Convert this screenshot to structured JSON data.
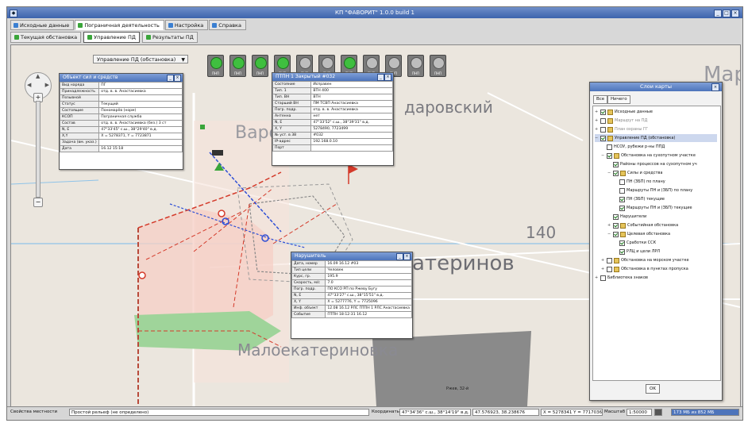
{
  "window": {
    "title": "КП \"ФАВОРИТ\" 1.0.0 build 1",
    "controls": [
      "_",
      "□",
      "×"
    ]
  },
  "tabs": [
    {
      "label": "Исходные данные",
      "color": "#3b7fd1",
      "active": false
    },
    {
      "label": "Пограничная деятельность",
      "color": "#3aa53a",
      "active": true
    },
    {
      "label": "Настройка",
      "color": "#3b7fd1",
      "active": false
    },
    {
      "label": "Справка",
      "color": "#3b7fd1",
      "active": false
    }
  ],
  "subtabs": [
    {
      "label": "Текущая обстановка",
      "active": false
    },
    {
      "label": "Управление ПД",
      "active": true
    },
    {
      "label": "Результаты ПД",
      "active": false
    }
  ],
  "mode_select": {
    "value": "Управление ПД (обстановка)"
  },
  "toolbar_buttons": [
    {
      "label": "ПНП",
      "state": "green"
    },
    {
      "label": "ПНП",
      "state": "green"
    },
    {
      "label": "ПНП",
      "state": "green"
    },
    {
      "label": "ПНП",
      "state": "green"
    },
    {
      "label": "ПНП",
      "state": "grey"
    },
    {
      "label": "ПНП",
      "state": "grey"
    },
    {
      "label": "ПНП",
      "state": "green"
    },
    {
      "label": "ПНП",
      "state": "grey"
    },
    {
      "label": "ПНП",
      "state": "grey"
    },
    {
      "label": "ПНП",
      "state": "grey"
    },
    {
      "label": "ПНП",
      "state": "grey"
    }
  ],
  "map_labels": {
    "place1": "Варе",
    "place2": "даровский",
    "place3": "атеринов",
    "place4": "Малоекатериновка",
    "place5": "Мар",
    "number": "140",
    "field": "Ржев, 32-й"
  },
  "win_object": {
    "title": "Объект сил и средств",
    "rows": [
      [
        "Вид наряда",
        "ПГ"
      ],
      [
        "Принадлежность",
        "отд. в. в. Анастасиевка"
      ],
      [
        "Позывной",
        ""
      ],
      [
        "Статус",
        "Текущий"
      ],
      [
        "Состоящие",
        "Пономарёв (норм)"
      ],
      [
        "КСОП",
        "Пограничная служба"
      ],
      [
        "Состав",
        "отд. в. в. Анастасиевка (без.) 3 ст"
      ],
      [
        "N, E",
        "47°33'45\" с.ш., 38°29'40\" в.д."
      ],
      [
        "X,Y",
        "X = 5278371, Y = 7723871"
      ],
      [
        "Задача (вм. указ.)",
        ""
      ],
      [
        "Дата",
        "16.12 15:18"
      ]
    ]
  },
  "win_ptpn": {
    "title": "ПТПН 1 Закрытый #032",
    "rows": [
      [
        "Состояние",
        "Исправен"
      ],
      [
        "Тип. 1",
        "ВТН 400"
      ],
      [
        "Тип. ВН",
        "ВТН"
      ],
      [
        "Старший ВН",
        "ПМ ТСВП Анастасиевка"
      ],
      [
        "Погр. подр.",
        "отд. в. в. Анастасиевка"
      ],
      [
        "Антенна",
        "нет"
      ],
      [
        "N, E",
        "47°33'52\" с.ш., 38°39'31\" в.д."
      ],
      [
        "X, Y",
        "5278490, 7723499"
      ],
      [
        "№ уст. в 38",
        "#032"
      ],
      [
        "IP-адрес",
        "192.168.0.10"
      ],
      [
        "Порт",
        ""
      ]
    ]
  },
  "win_violator": {
    "title": "Нарушитель",
    "rows": [
      [
        "Дата, номер",
        "16.09 16.12 #03"
      ],
      [
        "Тип цели",
        "Человек"
      ],
      [
        "Курс, гр.",
        "195.9"
      ],
      [
        "Скорость, м/с",
        "7.0"
      ],
      [
        "Погр. подр.",
        "ПО КСО РП по Ржеву Бугу"
      ],
      [
        "N, E",
        "47°33'27\" с.ш., 38°15'51\" в.д."
      ],
      [
        "X, Y",
        "X = 5277776, Y = 7725096"
      ],
      [
        "Инф. объект",
        "12.08 16.12 РЛС ПТПН 1 РЛС Анастасиевка"
      ],
      [
        "Событие",
        "ПТПН 18:12:31 16.12"
      ]
    ]
  },
  "layers_panel": {
    "title": "Слои карты",
    "btn_all": "Все",
    "btn_none": "Ничего",
    "ok": "OK",
    "items": [
      {
        "label": "Исходные данные",
        "depth": 0,
        "checked": true,
        "folder": true,
        "exp": "+"
      },
      {
        "label": "Маршрут на ПД",
        "depth": 0,
        "checked": false,
        "folder": true,
        "exp": "+"
      },
      {
        "label": "План охраны ГГ",
        "depth": 0,
        "checked": false,
        "folder": true,
        "exp": "+"
      },
      {
        "label": "Управление ПД (обстановка)",
        "depth": 0,
        "checked": true,
        "folder": true,
        "exp": "−",
        "selected": true
      },
      {
        "label": "НСОУ, рубежи р-ны ППД",
        "depth": 1,
        "checked": false,
        "folder": false,
        "exp": ""
      },
      {
        "label": "Обстановка на сухопутном участке",
        "depth": 1,
        "checked": true,
        "folder": true,
        "exp": "−"
      },
      {
        "label": "Районы процессов на сухопутном уч",
        "depth": 2,
        "checked": true,
        "folder": false,
        "exp": ""
      },
      {
        "label": "Силы и средства",
        "depth": 2,
        "checked": true,
        "folder": true,
        "exp": "−"
      },
      {
        "label": "ПН (ЗБП) по плану",
        "depth": 3,
        "checked": false,
        "folder": false,
        "exp": ""
      },
      {
        "label": "Маршруты ПН и (ЗБП) по плану",
        "depth": 3,
        "checked": false,
        "folder": false,
        "exp": ""
      },
      {
        "label": "ПН (ЗБП) текущие",
        "depth": 3,
        "checked": true,
        "folder": false,
        "exp": ""
      },
      {
        "label": "Маршруты ПН и (ЗБП) текущие",
        "depth": 3,
        "checked": true,
        "folder": false,
        "exp": ""
      },
      {
        "label": "Нарушители",
        "depth": 2,
        "checked": true,
        "folder": false,
        "exp": ""
      },
      {
        "label": "Событийная обстановка",
        "depth": 2,
        "checked": true,
        "folder": true,
        "exp": "+"
      },
      {
        "label": "Целевая обстановка",
        "depth": 2,
        "checked": true,
        "folder": true,
        "exp": "−"
      },
      {
        "label": "Сработки ССК",
        "depth": 3,
        "checked": true,
        "folder": false,
        "exp": ""
      },
      {
        "label": "РЛЦ и цели ЛРЛ",
        "depth": 3,
        "checked": true,
        "folder": false,
        "exp": ""
      },
      {
        "label": "Обстановка на морском участке",
        "depth": 1,
        "checked": false,
        "folder": true,
        "exp": "+"
      },
      {
        "label": "Обстановка в пунктах пропуска",
        "depth": 1,
        "checked": false,
        "folder": true,
        "exp": "+"
      },
      {
        "label": "Библиотека знаков",
        "depth": 0,
        "checked": false,
        "folder": false,
        "exp": "+"
      }
    ]
  },
  "statusbar": {
    "terrain_label": "Свойства местности",
    "terrain_value": "Простой рельеф (не определено)",
    "coords_label": "Координаты",
    "coords_geo": "47°34'36\" с.ш., 38°14'19\" в.д.",
    "coords_dec": "47.576923, 38.238676",
    "coords_xy": "X = 5278341 Y = 7717036",
    "scale_label": "Масштаб",
    "scale_value": "1:50000",
    "memory": "173 МБ из 852 МБ"
  },
  "colors": {
    "accent": "#4d74bb",
    "ok_green": "#3fbf3f",
    "route_red": "#d43a2a",
    "route_blue": "#2f4fd6",
    "forest": "#9fd49a"
  }
}
